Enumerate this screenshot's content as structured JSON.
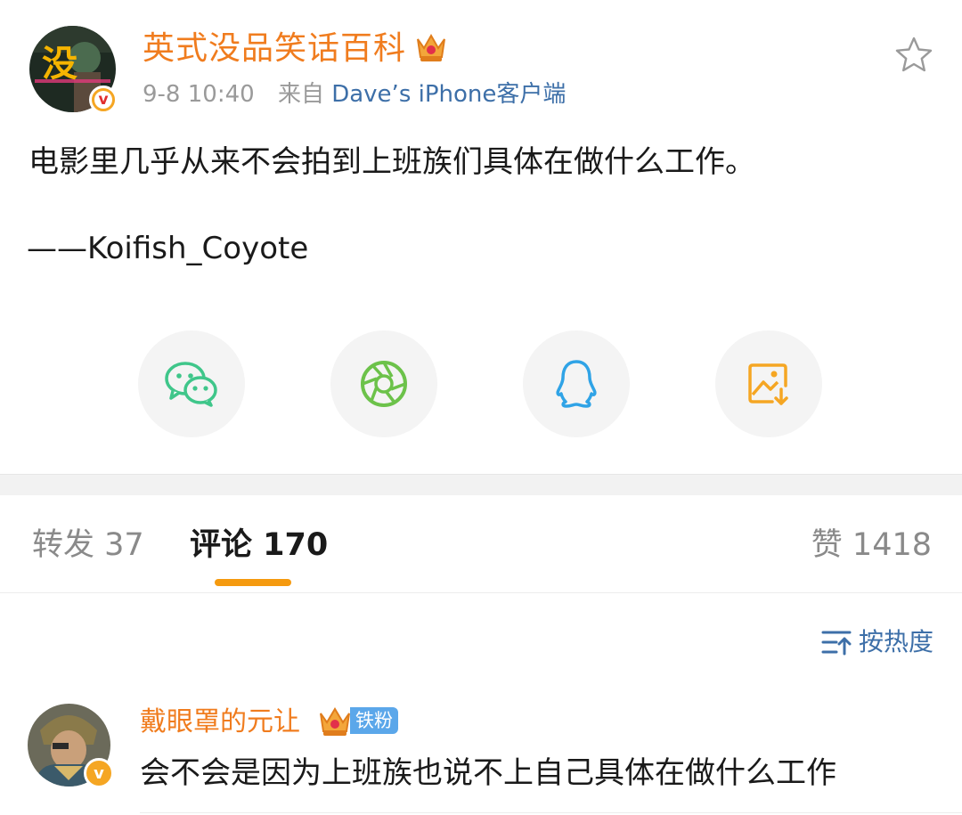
{
  "post": {
    "author": "英式没品笑话百科",
    "time": "9-8 10:40",
    "source_prefix": "来自",
    "source_app": "Dave’s iPhone客户端",
    "text": "电影里几乎从来不会拍到上班族们具体在做什么工作。",
    "signature": "——Koifish_Coyote",
    "avatar_text": "没",
    "share_targets": [
      "wechat-icon",
      "moments-icon",
      "qq-icon",
      "save-image-icon"
    ]
  },
  "tabs": {
    "repost": "转发 37",
    "comments": "评论 170",
    "likes": "赞 1418"
  },
  "sort": {
    "label": "按热度"
  },
  "comments": [
    {
      "user": "戴眼罩的元让",
      "badge": "铁粉",
      "text": "会不会是因为上班族也说不上自己具体在做什么工作"
    }
  ],
  "colors": {
    "accent_orange": "#f07c1e",
    "link_blue": "#3d6fa8",
    "tab_underline": "#f59a0f",
    "wechat_green": "#3fc68a",
    "moments_green": "#6cc24a",
    "qq_blue": "#2fa3e6",
    "save_orange": "#f5a623"
  }
}
